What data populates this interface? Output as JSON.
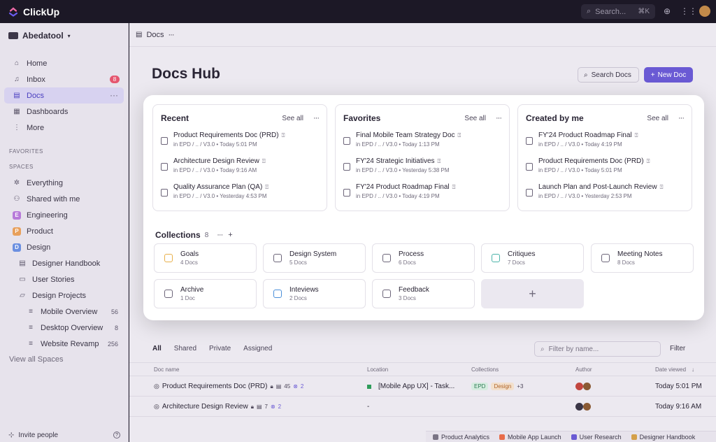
{
  "app": {
    "name": "ClickUp"
  },
  "topbar": {
    "search_placeholder": "Search...",
    "search_shortcut": "⌘K"
  },
  "sidebar": {
    "workspace": "Abedatool",
    "nav": [
      {
        "label": "Home"
      },
      {
        "label": "Inbox",
        "badge": "8"
      },
      {
        "label": "Docs"
      },
      {
        "label": "Dashboards"
      },
      {
        "label": "More"
      }
    ],
    "favorites_label": "FAVORITES",
    "spaces_label": "SPACES",
    "spaces": [
      {
        "label": "Everything"
      },
      {
        "label": "Shared with me"
      },
      {
        "label": "Engineering",
        "letter": "E",
        "color": "#b77ad9"
      },
      {
        "label": "Product",
        "letter": "P",
        "color": "#e8a05b"
      },
      {
        "label": "Design",
        "letter": "D",
        "color": "#6b8fe0"
      }
    ],
    "design_children": [
      {
        "label": "Designer Handbook"
      },
      {
        "label": "User Stories"
      },
      {
        "label": "Design Projects"
      }
    ],
    "projects": [
      {
        "label": "Mobile Overview",
        "count": "56"
      },
      {
        "label": "Desktop Overview",
        "count": "8"
      },
      {
        "label": "Website Revamp",
        "count": "256"
      }
    ],
    "view_all": "View all Spaces",
    "invite": "Invite people"
  },
  "breadcrumb": {
    "label": "Docs"
  },
  "page": {
    "title": "Docs Hub",
    "search_btn": "Search Docs",
    "new_btn": "New Doc"
  },
  "cards": [
    {
      "title": "Recent",
      "see_all": "See all",
      "docs": [
        {
          "title": "Product Requirements Doc (PRD)",
          "meta": "in EPD / .. / V3.0  •  Today 5:01 PM"
        },
        {
          "title": "Architecture Design Review",
          "meta": "in EPD / .. / V3.0  •  Today 9:16 AM"
        },
        {
          "title": "Quality Assurance Plan (QA)",
          "meta": "in EPD / .. / V3.0  •  Yesterday 4:53 PM"
        }
      ]
    },
    {
      "title": "Favorites",
      "see_all": "See all",
      "docs": [
        {
          "title": "Final Mobile Team Strategy Doc",
          "meta": "in EPD / .. / V3.0  •  Today 1:13 PM"
        },
        {
          "title": "FY'24 Strategic Initiatives",
          "meta": "in EPD / .. / V3.0  •  Yesterday 5:38 PM"
        },
        {
          "title": "FY'24 Product Roadmap Final",
          "meta": "in EPD / .. / V3.0  •  Today 4:19 PM"
        }
      ]
    },
    {
      "title": "Created by me",
      "see_all": "See all",
      "docs": [
        {
          "title": "FY'24 Product Roadmap Final",
          "meta": "in EPD / .. / V3.0  •  Today 4:19 PM"
        },
        {
          "title": "Product Requirements Doc (PRD)",
          "meta": "in EPD / .. / V3.0  •  Today 5:01 PM"
        },
        {
          "title": "Launch Plan and Post-Launch Review",
          "meta": "in EPD / .. / V3.0  •  Yesterday 2:53 PM"
        }
      ]
    }
  ],
  "collections": {
    "label": "Collections",
    "count": "8",
    "items": [
      {
        "name": "Goals",
        "sub": "4 Docs",
        "color": "#e8b04a"
      },
      {
        "name": "Design System",
        "sub": "5 Docs",
        "color": "#6c6579"
      },
      {
        "name": "Process",
        "sub": "6 Docs",
        "color": "#6c6579"
      },
      {
        "name": "Critiques",
        "sub": "7 Docs",
        "color": "#4bb3a9"
      },
      {
        "name": "Meeting Notes",
        "sub": "8 Docs",
        "color": "#6c6579"
      },
      {
        "name": "Archive",
        "sub": "1 Doc",
        "color": "#6c6579"
      },
      {
        "name": "Inteviews",
        "sub": "2 Docs",
        "color": "#4b8fd9"
      },
      {
        "name": "Feedback",
        "sub": "3 Docs",
        "color": "#6c6579"
      }
    ]
  },
  "list": {
    "tabs": [
      "All",
      "Shared",
      "Private",
      "Assigned"
    ],
    "filter_placeholder": "Filter by name...",
    "filter_btn": "Filter",
    "headers": [
      "Doc name",
      "Location",
      "Collections",
      "Author",
      "Date viewed"
    ],
    "rows": [
      {
        "name": "Product Requirements Doc (PRD)",
        "pages": "45",
        "shares": "2",
        "location": "[Mobile App UX] - Task...",
        "chip1": "EPD",
        "chip2": "Design",
        "more": "+3",
        "date": "Today 5:01 PM"
      },
      {
        "name": "Architecture Design Review",
        "pages": "7",
        "shares": "2",
        "location": "-",
        "chip1": "",
        "chip2": "",
        "more": "",
        "date": "Today 9:16 AM"
      }
    ]
  },
  "bottombar": [
    {
      "label": "Product Analytics",
      "color": "#7a7485"
    },
    {
      "label": "Mobile App Launch",
      "color": "#e86c4a"
    },
    {
      "label": "User Research",
      "color": "#6a5ad4"
    },
    {
      "label": "Designer Handbook",
      "color": "#d4a04a"
    }
  ]
}
